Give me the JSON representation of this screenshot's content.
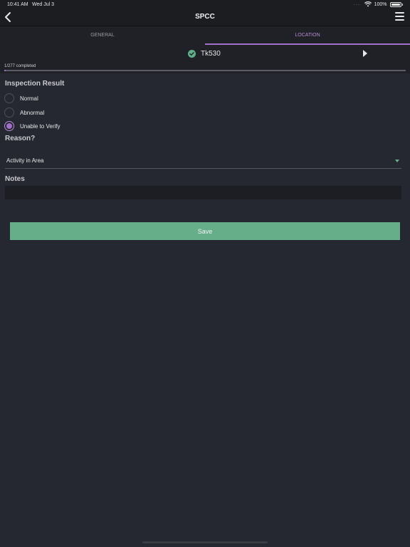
{
  "status_bar": {
    "time": "10:41 AM",
    "date": "Wed Jul 3",
    "signal_dots": "....",
    "battery_percent": "100%"
  },
  "nav": {
    "title": "SPCC"
  },
  "tabs": [
    {
      "label": "GENERAL",
      "selected": false
    },
    {
      "label": "LOCATION",
      "selected": true
    }
  ],
  "current_item": {
    "name": "Tk530",
    "completed": true
  },
  "progress": {
    "text": "1/277 completed",
    "completed": 1,
    "total": 277
  },
  "inspection": {
    "heading": "Inspection Result",
    "options": [
      {
        "label": "Normal",
        "selected": false
      },
      {
        "label": "Abnormal",
        "selected": false
      },
      {
        "label": "Unable to Verify",
        "selected": true
      }
    ]
  },
  "reason": {
    "heading": "Reason?",
    "value": "Activity in Area"
  },
  "notes": {
    "heading": "Notes",
    "value": ""
  },
  "save_label": "Save",
  "colors": {
    "background": "#252830",
    "accent_purple": "#a070c8",
    "save_green": "#66ad8a",
    "check_green": "#5fb08a"
  }
}
